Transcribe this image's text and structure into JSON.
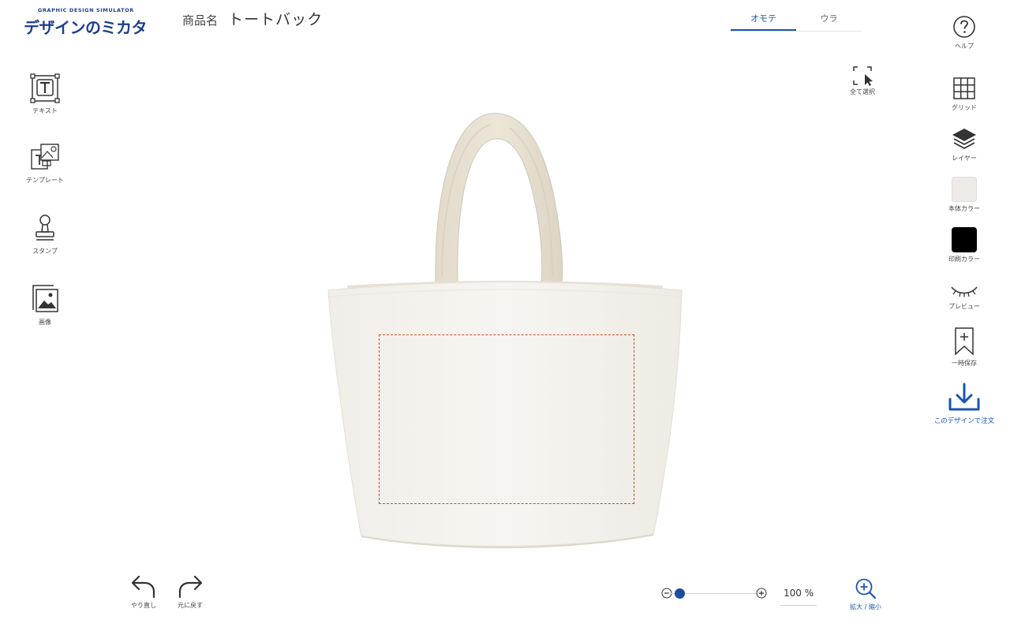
{
  "app": {
    "logo_subtitle": "GRAPHIC DESIGN SIMULATOR",
    "logo_text": "デザインのミカタ"
  },
  "product": {
    "label": "商品名",
    "name": "トートバック"
  },
  "tabs": [
    {
      "label": "オモテ",
      "active": true
    },
    {
      "label": "ウラ",
      "active": false
    }
  ],
  "left_tools": [
    {
      "label": "テキスト",
      "icon": "text-tool-icon"
    },
    {
      "label": "テンプレート",
      "icon": "template-icon"
    },
    {
      "label": "スタンプ",
      "icon": "stamp-icon"
    },
    {
      "label": "画像",
      "icon": "image-icon"
    }
  ],
  "select_all": {
    "label": "全て選択",
    "icon": "select-all-icon"
  },
  "right_tools": {
    "help": {
      "label": "ヘルプ",
      "icon": "help-icon"
    },
    "grid": {
      "label": "グリッド",
      "icon": "grid-icon"
    },
    "layer": {
      "label": "レイヤー",
      "icon": "layers-icon"
    },
    "body_color": {
      "label": "本体カラー",
      "color": "#eeebe6"
    },
    "print_color": {
      "label": "印刷カラー",
      "color": "#000000"
    },
    "preview": {
      "label": "プレビュー",
      "icon": "eye-closed-icon"
    },
    "save": {
      "label": "一時保存",
      "icon": "bookmark-add-icon"
    },
    "order": {
      "label": "このデザインで注文",
      "icon": "download-icon"
    }
  },
  "history": {
    "undo_label": "やり直し",
    "redo_label": "元に戻す"
  },
  "zoom": {
    "value_text": "100 %",
    "level_fraction": 0.12,
    "zoom_label": "拡大 / 縮小"
  },
  "colors": {
    "accent": "#1a55b0",
    "print_area_border": "#c0502a"
  }
}
